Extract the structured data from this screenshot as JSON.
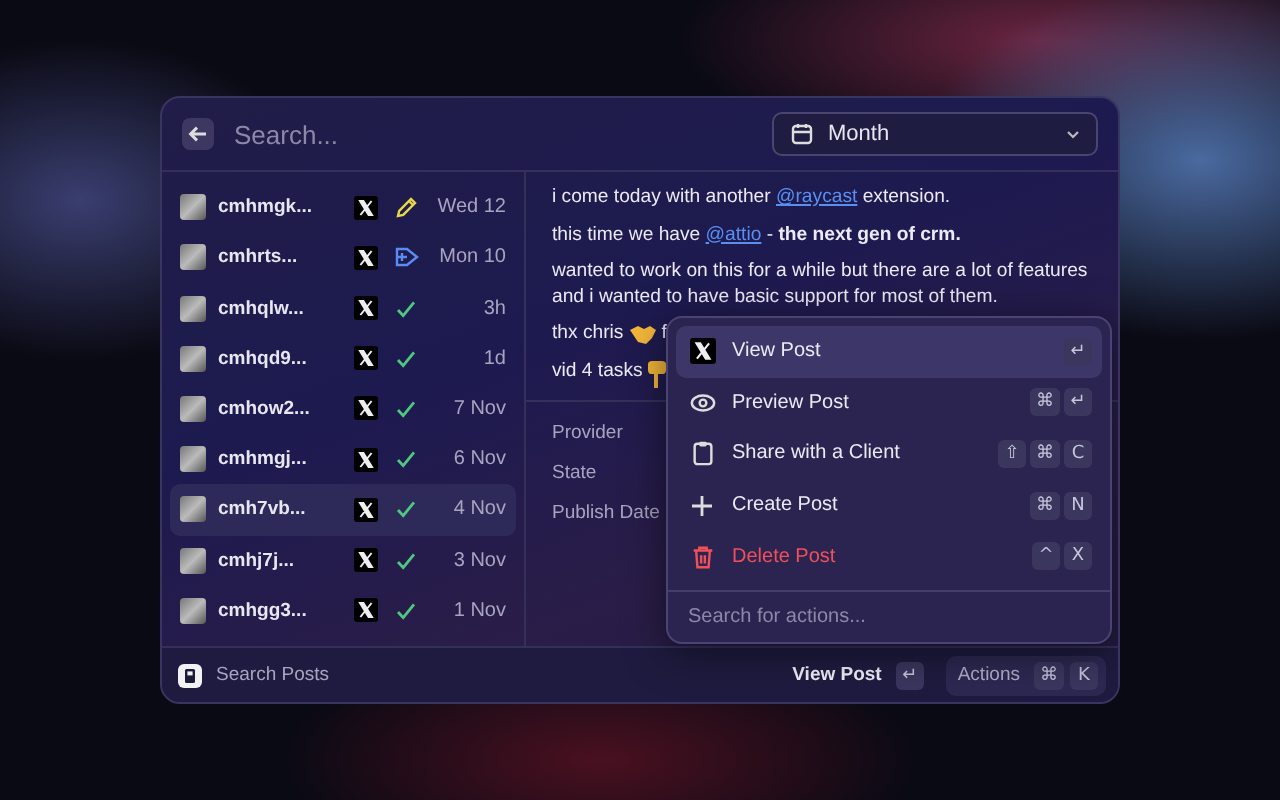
{
  "header": {
    "search": {
      "placeholder": "Search..."
    },
    "filter": {
      "value": "Month"
    }
  },
  "posts": [
    {
      "title": "cmhmgk...",
      "kind": "draft",
      "date": "Wed 12",
      "selected": false
    },
    {
      "title": "cmhrts...",
      "kind": "scheduled",
      "date": "Mon 10",
      "selected": false
    },
    {
      "title": "cmhqlw...",
      "kind": "published",
      "date": "3h",
      "selected": false
    },
    {
      "title": "cmhqd9...",
      "kind": "published",
      "date": "1d",
      "selected": false
    },
    {
      "title": "cmhow2...",
      "kind": "published",
      "date": "7 Nov",
      "selected": false
    },
    {
      "title": "cmhmgj...",
      "kind": "published",
      "date": "6 Nov",
      "selected": false
    },
    {
      "title": "cmh7vb...",
      "kind": "published",
      "date": "4 Nov",
      "selected": true
    },
    {
      "title": "cmhj7j...",
      "kind": "published",
      "date": "3 Nov",
      "selected": false
    },
    {
      "title": "cmhgg3...",
      "kind": "published",
      "date": "1 Nov",
      "selected": false
    }
  ],
  "detail": {
    "paragraphs": [
      [
        {
          "kind": "text",
          "text": "i come today with another "
        },
        {
          "kind": "link",
          "text": "@raycast"
        },
        {
          "kind": "text",
          "text": " extension."
        }
      ],
      [
        {
          "kind": "text",
          "text": "this time we have "
        },
        {
          "kind": "link",
          "text": "@attio"
        },
        {
          "kind": "text",
          "text": " - "
        },
        {
          "kind": "bold",
          "text": "the next gen of crm."
        }
      ],
      [
        {
          "kind": "text",
          "text": "wanted to work on this for a while but there are a lot of features and i wanted to have basic support for most of them."
        }
      ],
      [
        {
          "kind": "text",
          "text": "thx chris "
        },
        {
          "kind": "handshake"
        },
        {
          "kind": "text",
          "text": " f"
        }
      ],
      [
        {
          "kind": "text",
          "text": "vid 4 tasks "
        },
        {
          "kind": "pointer"
        }
      ]
    ],
    "metadata": [
      {
        "label": "Provider"
      },
      {
        "label": "State"
      },
      {
        "label": "Publish Date"
      }
    ]
  },
  "actions_menu": {
    "items": [
      {
        "label": "View Post",
        "kind": "view",
        "keys": [
          "↵"
        ],
        "selected": true,
        "destructive": false
      },
      {
        "label": "Preview Post",
        "kind": "preview",
        "keys": [
          "⌘",
          "↵"
        ],
        "selected": false,
        "destructive": false
      },
      {
        "label": "Share with a Client",
        "kind": "share",
        "keys": [
          "⇧",
          "⌘",
          "C"
        ],
        "selected": false,
        "destructive": false
      },
      {
        "label": "Create Post",
        "kind": "create",
        "keys": [
          "⌘",
          "N"
        ],
        "selected": false,
        "destructive": false
      },
      {
        "label": "Delete Post",
        "kind": "delete",
        "keys": [
          "^",
          "X"
        ],
        "selected": false,
        "destructive": true
      }
    ],
    "search": {
      "placeholder": "Search for actions..."
    }
  },
  "footer": {
    "title": "Search Posts",
    "primary_action": {
      "label": "View Post",
      "keys": [
        "↵"
      ]
    },
    "actions": {
      "label": "Actions",
      "keys": [
        "⌘",
        "K"
      ]
    }
  }
}
